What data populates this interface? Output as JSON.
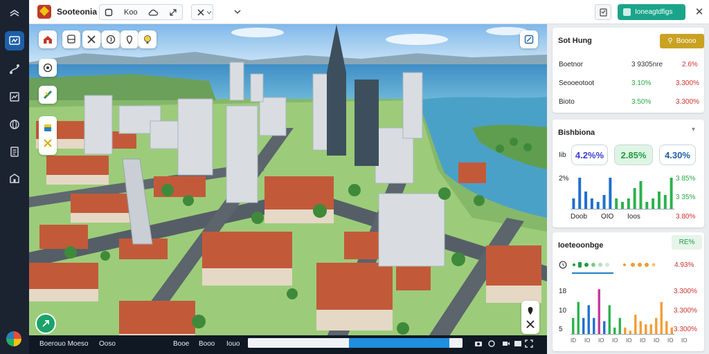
{
  "app": {
    "title": "Sooteonia"
  },
  "toolbar": {
    "label": "Koo"
  },
  "primary_button": {
    "label": "Ioneagtdfigs"
  },
  "rail_icons": [
    "collapse-icon",
    "map-dashboard-icon",
    "route-icon",
    "analytics-icon",
    "globe-icon",
    "report-icon",
    "building-icon"
  ],
  "map_tools": [
    "house-icon",
    "bus-icon",
    "close-tool-icon",
    "compass-icon",
    "pin-icon",
    "lamp-icon"
  ],
  "map_side_tools": [
    "layers-icon",
    "measure-icon",
    "legend-icon",
    "pin-marker-icon"
  ],
  "timeline": {
    "left_label": "Boerouo Moeso",
    "mid_label": "Ooso",
    "track_label_a": "Booe",
    "track_label_b": "Booo",
    "track_label_c": "Iouo",
    "progress": 0.47
  },
  "panel": {
    "set_card": {
      "title": "Sot Hung",
      "button_label": "Boooo",
      "rows": [
        {
          "label": "Boetnor",
          "value1": "3 9305nre",
          "value2": "2.6%"
        },
        {
          "label": "Seooeotoot",
          "value1": "3.10%",
          "value2": "3.300%"
        },
        {
          "label": "Bioto",
          "value1": "3.50%",
          "value2": "3.300%"
        }
      ]
    },
    "stats_card": {
      "title": "Bishbiona",
      "pills": [
        "4.2%%",
        "2.85%",
        "4.30%"
      ],
      "axis_top": "2%",
      "x_labels": [
        "Doob",
        "OIO",
        "Ioos"
      ],
      "right_values": [
        "3 85%",
        "3 35%",
        "3.80%"
      ],
      "row_prefix": "Iib"
    },
    "trend_card": {
      "title": "Ioeteoonbge",
      "badge": "RE%",
      "legend_value": "4.93%",
      "y_labels": [
        "18",
        "10",
        "5"
      ],
      "right_values": [
        "3.300%",
        "3.300%",
        "3.300%"
      ],
      "x_labels": [
        "ID",
        "IO",
        "IO",
        "IO",
        "IO",
        "IO",
        "IO",
        "IO",
        "IO"
      ]
    }
  },
  "chart_data": [
    {
      "type": "bar",
      "categories": [
        "b1",
        "b2",
        "b3",
        "b4",
        "b5",
        "b6",
        "b7",
        "b8",
        "b9",
        "b10",
        "b11",
        "b12",
        "b13",
        "b14",
        "b15",
        "b16",
        "b17"
      ],
      "series": [
        {
          "values": [
            3,
            9,
            5,
            3,
            2,
            4,
            9,
            3,
            2,
            3,
            6,
            8,
            2,
            3,
            5,
            4,
            9
          ]
        }
      ],
      "colors": [
        "#1f6fd0",
        "#1f6fd0",
        "#1f6fd0",
        "#1f6fd0",
        "#1f6fd0",
        "#1f6fd0",
        "#1f6fd0",
        "#2bb24c",
        "#2bb24c",
        "#2bb24c",
        "#2bb24c",
        "#2bb24c",
        "#2bb24c",
        "#2bb24c",
        "#2bb24c",
        "#2bb24c",
        "#2bb24c"
      ],
      "ylim": [
        0,
        10
      ]
    },
    {
      "type": "bar",
      "categories": [
        "c1",
        "c2",
        "c3",
        "c4",
        "c5",
        "c6",
        "c7",
        "c8",
        "c9",
        "c10",
        "c11",
        "c12",
        "c13",
        "c14",
        "c15",
        "c16",
        "c17",
        "c18",
        "c19",
        "c20"
      ],
      "series": [
        {
          "values": [
            5,
            10,
            5,
            9,
            5,
            14,
            4,
            9,
            2,
            5,
            2,
            1,
            6,
            4,
            3,
            3,
            5,
            10,
            4,
            2
          ]
        }
      ],
      "colors": [
        "#2bb24c",
        "#2bb24c",
        "#1f6fd0",
        "#1f6fd0",
        "#1f6fd0",
        "#c03a9a",
        "#1f6fd0",
        "#2bb24c",
        "#2bb24c",
        "#2bb24c",
        "#f39c34",
        "#f39c34",
        "#f39c34",
        "#f39c34",
        "#f39c34",
        "#f39c34",
        "#f39c34",
        "#f39c34",
        "#f39c34",
        "#f39c34"
      ],
      "ylim": [
        0,
        16
      ]
    }
  ]
}
